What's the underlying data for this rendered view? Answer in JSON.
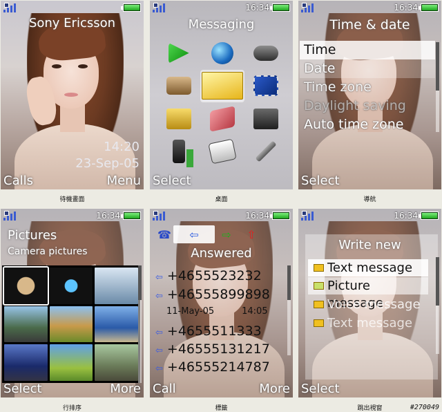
{
  "status": {
    "time": "16:34"
  },
  "screens": {
    "standby": {
      "title": "Sony Ericsson",
      "time": "14:20",
      "date": "23-Sep-05",
      "left": "Calls",
      "right": "Menu",
      "caption": "待機畫面"
    },
    "desktop": {
      "title": "Messaging",
      "left": "Select",
      "caption": "桌面",
      "icons": [
        "play-icon",
        "globe-phone-icon",
        "gamepad-icon",
        "camera-icon",
        "envelope-icon",
        "film-icon",
        "folder-icon",
        "book-icon",
        "radio-icon",
        "phone-info-icon",
        "calendar-icon",
        "wrench-icon"
      ]
    },
    "navigation": {
      "title": "Time & date",
      "left": "Select",
      "caption": "導航",
      "items": [
        "Time",
        "Date",
        "Time zone",
        "Daylight saving",
        "Auto time zone"
      ]
    },
    "pictures": {
      "title": "Pictures",
      "subtitle": "Camera pictures",
      "left": "Select",
      "right": "More",
      "caption": "行排序"
    },
    "calls": {
      "title": "Answered",
      "left": "Call",
      "right": "More",
      "caption": "標籤",
      "entries": [
        "+4655523232",
        "+46555899898",
        "+4655511333",
        "+46555131217",
        "+46555214787"
      ],
      "detail_date": "11-May-05",
      "detail_time": "14:05"
    },
    "write": {
      "title": "Write new",
      "left": "Select",
      "caption": "跳出視窗",
      "items": [
        "Text message",
        "Picture message",
        "Voice message",
        "Text message"
      ]
    }
  },
  "watermark": "#270049"
}
